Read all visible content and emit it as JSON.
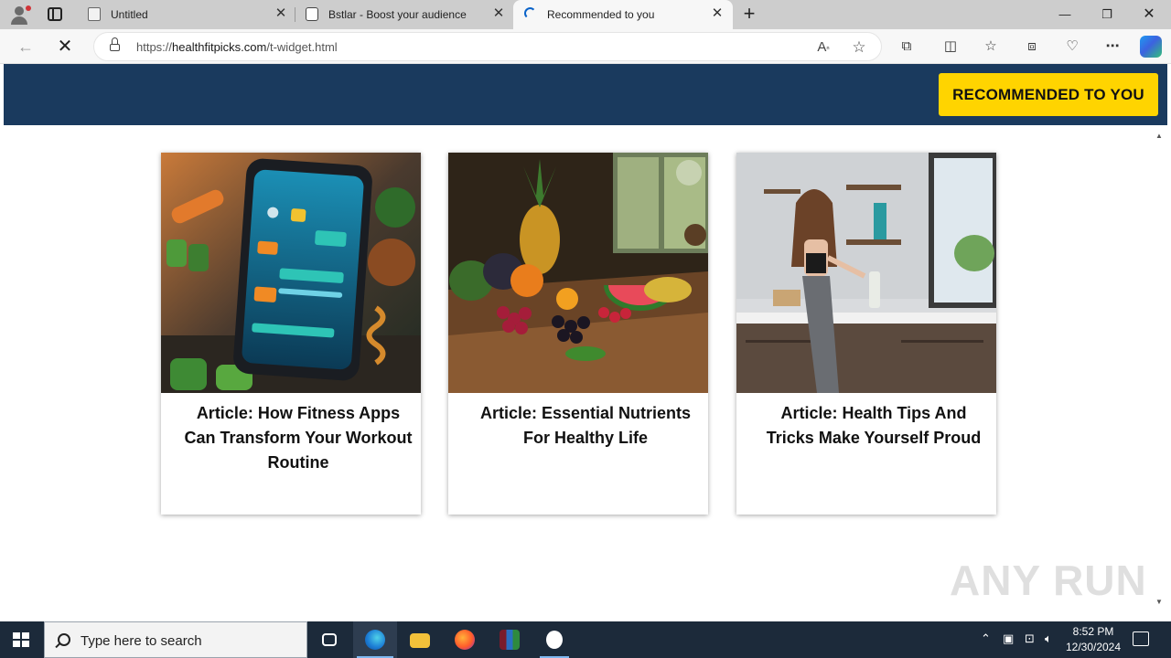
{
  "browser": {
    "tabs": [
      {
        "title": "Untitled",
        "icon": "document-icon"
      },
      {
        "title": "Bstlar - Boost your audience",
        "icon": "chat-icon"
      },
      {
        "title": "Recommended to you",
        "icon": "loading-spinner-icon",
        "active": true
      }
    ],
    "url": {
      "scheme": "https://",
      "host": "healthfitpicks.com",
      "path": "/t-widget.html"
    },
    "window_controls": [
      "minimize-icon",
      "restore-icon",
      "close-icon"
    ]
  },
  "page": {
    "header": {
      "badge_label": "RECOMMENDED TO YOU",
      "background": "#1a3a5e",
      "badge_color": "#ffd400"
    },
    "articles": [
      {
        "title": "Article: How Fitness Apps Can Transform Your Workout Routine",
        "image": "fitness-app-phone-image"
      },
      {
        "title": "Article: Essential Nutrients For Healthy Life",
        "image": "fruit-table-image"
      },
      {
        "title": "Article: Health Tips And Tricks Make Yourself Proud",
        "image": "kitchen-woman-image"
      }
    ],
    "watermark": "ANY RUN"
  },
  "taskbar": {
    "search_placeholder": "Type here to search",
    "time": "8:52 PM",
    "date": "12/30/2024"
  }
}
